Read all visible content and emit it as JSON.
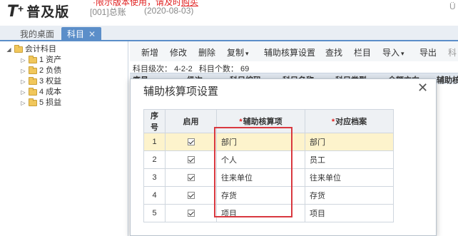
{
  "header": {
    "logo_t": "T",
    "logo_plus": "+",
    "logo_name": "普及版",
    "notice_prefix": "·限示版本使用，请及时",
    "notice_link": "购买",
    "account": "[001]总账",
    "date": "(2020-08-03)",
    "corner": "Ü"
  },
  "tabs": [
    {
      "label": "我的桌面"
    },
    {
      "label": "科目",
      "close": "✕"
    }
  ],
  "tree": {
    "root": {
      "toggle": "◢",
      "label": "会计科目"
    },
    "items": [
      {
        "toggle": "▷",
        "label": "1 资产"
      },
      {
        "toggle": "▷",
        "label": "2 负债"
      },
      {
        "toggle": "▷",
        "label": "3 权益"
      },
      {
        "toggle": "▷",
        "label": "4 成本"
      },
      {
        "toggle": "▷",
        "label": "5 损益"
      }
    ]
  },
  "toolbar": {
    "add": "新增",
    "edit": "修改",
    "delete": "删除",
    "copy": "复制",
    "aux_setup": "辅助核算设置",
    "find": "查找",
    "columns": "栏目",
    "import": "导入",
    "export": "导出",
    "more": "科",
    "caret": "▾"
  },
  "info": {
    "level_label": "科目级次：",
    "level_value": "4-2-2",
    "count_label": "科目个数：",
    "count_value": "69"
  },
  "grid_header": [
    "序号",
    "级次",
    "科目编码",
    "科目名称",
    "科目类型",
    "余额方向",
    "辅助核"
  ],
  "modal": {
    "title": "辅助核算项设置",
    "close": "✕",
    "columns": {
      "seq": "序号",
      "enabled": "启用",
      "aux_item": "辅助核算项",
      "archive": "对应档案",
      "required_mark": "*"
    },
    "rows": [
      {
        "seq": "1",
        "enabled": true,
        "aux_item": "部门",
        "archive": "部门"
      },
      {
        "seq": "2",
        "enabled": true,
        "aux_item": "个人",
        "archive": "员工"
      },
      {
        "seq": "3",
        "enabled": true,
        "aux_item": "往来单位",
        "archive": "往来单位"
      },
      {
        "seq": "4",
        "enabled": true,
        "aux_item": "存货",
        "archive": "存货"
      },
      {
        "seq": "5",
        "enabled": true,
        "aux_item": "项目",
        "archive": "项目"
      }
    ]
  },
  "colors": {
    "accent_blue": "#5b8ec9",
    "selected_row": "#fdf3cc",
    "highlight_red": "#d9383f"
  }
}
